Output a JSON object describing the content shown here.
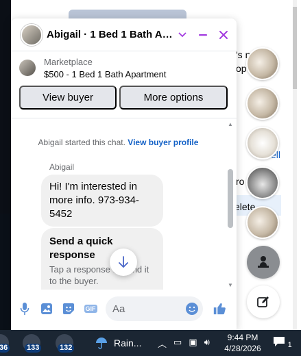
{
  "chat": {
    "title": "Abigail · 1 Bed 1 Bath Apartment",
    "listing_source": "Marketplace",
    "listing_name": "$500 - 1 Bed 1 Bath Apartment",
    "buttons": {
      "view_buyer": "View buyer",
      "more_options": "More options"
    },
    "system_prefix": "Abigail started this chat.",
    "system_link": "View buyer profile",
    "sender": "Abigail",
    "message": "Hi! I'm interested in more info. 973-934-5452",
    "quick_title": "Send a quick response",
    "quick_sub": "Tap a response to send it to the buyer.",
    "input_placeholder": "Aa",
    "accent": "#a33be0"
  },
  "background": {
    "frag1": "'s n",
    "frag2": "op",
    "frag3": "sell",
    "frag4": "ro",
    "frag5": "elete"
  },
  "taskbar": {
    "badge1": "36",
    "badge2": "133",
    "badge3": "132",
    "weather": "Rain...",
    "time": "9:44 PM",
    "date": "4/28/2026",
    "notifications": "1"
  }
}
